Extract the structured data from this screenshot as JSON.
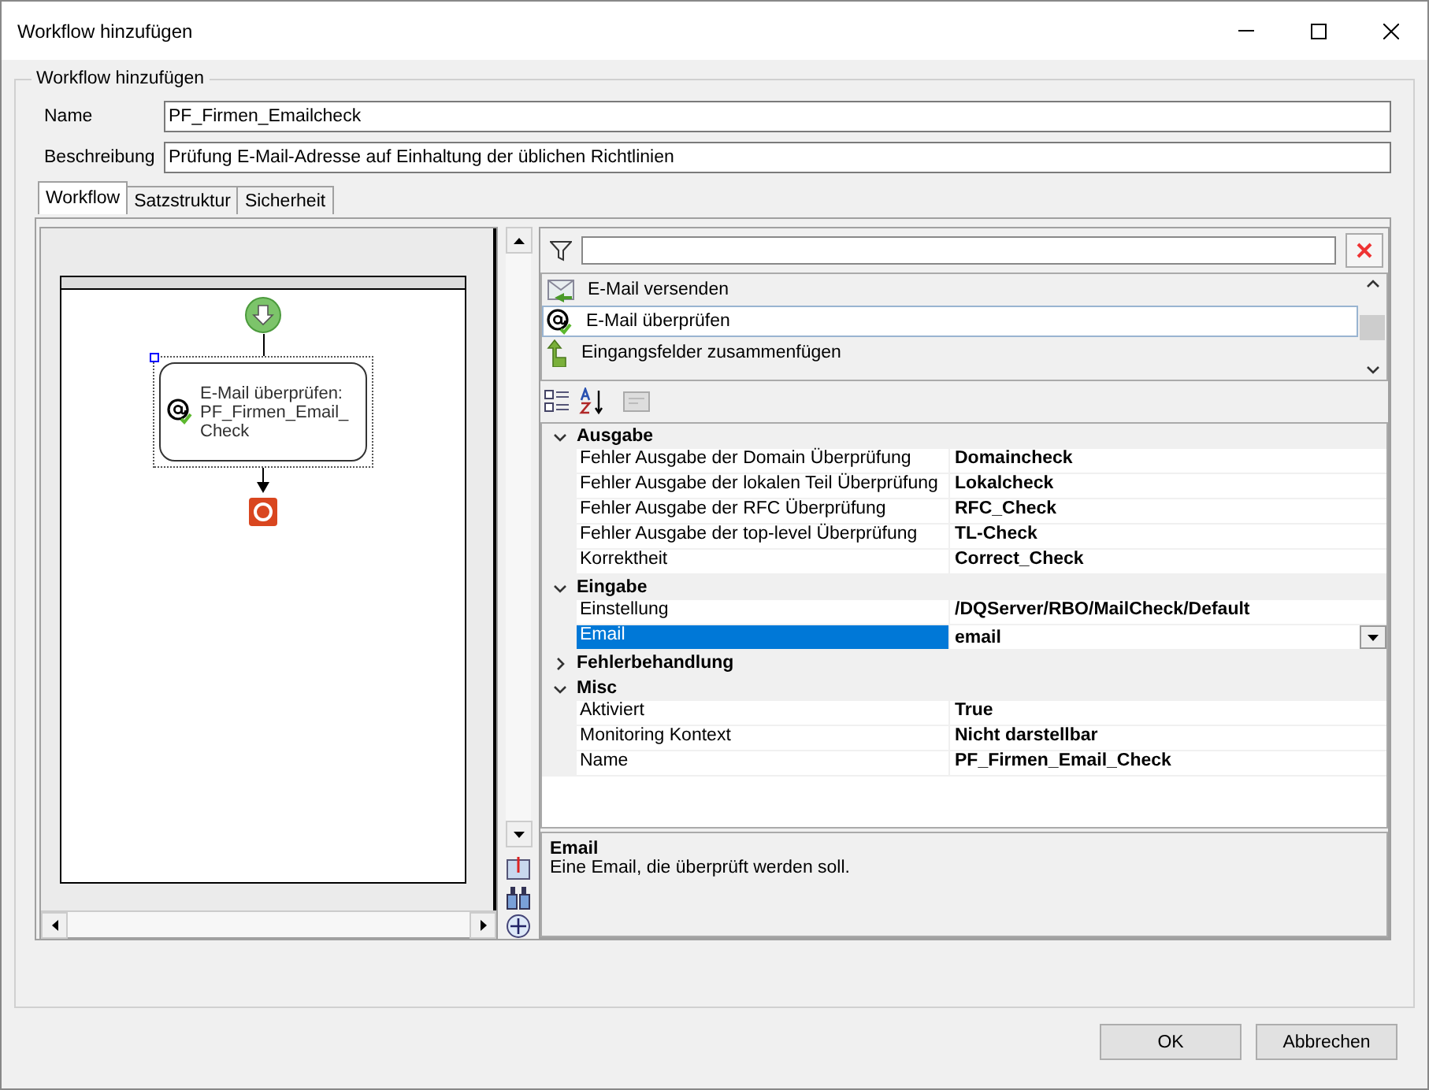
{
  "window": {
    "title": "Workflow hinzufügen"
  },
  "group": {
    "title": "Workflow hinzufügen"
  },
  "fields": [
    {
      "label": "Name",
      "value": "PF_Firmen_Emailcheck"
    },
    {
      "label": "Beschreibung",
      "value": "Prüfung E-Mail-Adresse auf Einhaltung der üblichen Richtlinien"
    }
  ],
  "tabs": [
    {
      "label": "Workflow",
      "selected": true
    },
    {
      "label": "Satzstruktur",
      "selected": false
    },
    {
      "label": "Sicherheit",
      "selected": false
    }
  ],
  "designer": {
    "activity": {
      "lines": [
        "E-Mail überprüfen:",
        "PF_Firmen_Email_",
        "Check"
      ],
      "selected": true
    }
  },
  "toolbox": {
    "activities": [
      {
        "label": "E-Mail versenden",
        "kind": "mail",
        "selected": false
      },
      {
        "label": "E-Mail überprüfen",
        "kind": "at",
        "selected": true
      },
      {
        "label": "Eingangsfelder zusammenfügen",
        "kind": "merge",
        "selected": false
      }
    ]
  },
  "properties": {
    "categories": [
      {
        "name": "Ausgabe",
        "expanded": true,
        "rows": [
          {
            "name": "Fehler Ausgabe der Domain Überprüfung",
            "value": "Domaincheck",
            "selected": false,
            "kind": "text"
          },
          {
            "name": "Fehler Ausgabe der lokalen Teil Überprüfung",
            "value": "Lokalcheck",
            "selected": false,
            "kind": "text"
          },
          {
            "name": "Fehler Ausgabe der RFC Überprüfung",
            "value": "RFC_Check",
            "selected": false,
            "kind": "text"
          },
          {
            "name": "Fehler Ausgabe der top-level Überprüfung",
            "value": "TL-Check",
            "selected": false,
            "kind": "text"
          },
          {
            "name": "Korrektheit",
            "value": "Correct_Check",
            "selected": false,
            "kind": "text"
          }
        ]
      },
      {
        "name": "Eingabe",
        "expanded": true,
        "rows": [
          {
            "name": "Einstellung",
            "value": "/DQServer/RBO/MailCheck/Default",
            "selected": false,
            "kind": "text"
          },
          {
            "name": "Email",
            "value": "email",
            "selected": true,
            "kind": "dropdown"
          }
        ]
      },
      {
        "name": "Fehlerbehandlung",
        "expanded": false
      },
      {
        "name": "Misc",
        "expanded": true,
        "rows": [
          {
            "name": "Aktiviert",
            "value": "True",
            "selected": false,
            "kind": "text"
          },
          {
            "name": "Monitoring Kontext",
            "value": "Nicht darstellbar",
            "selected": false,
            "kind": "text"
          },
          {
            "name": "Name",
            "value": "PF_Firmen_Email_Check",
            "selected": false,
            "kind": "text"
          }
        ]
      }
    ]
  },
  "description": {
    "title": "Email",
    "text": "Eine Email, die überprüft werden soll."
  },
  "buttons": [
    {
      "label": "OK"
    },
    {
      "label": "Abbrechen"
    }
  ]
}
